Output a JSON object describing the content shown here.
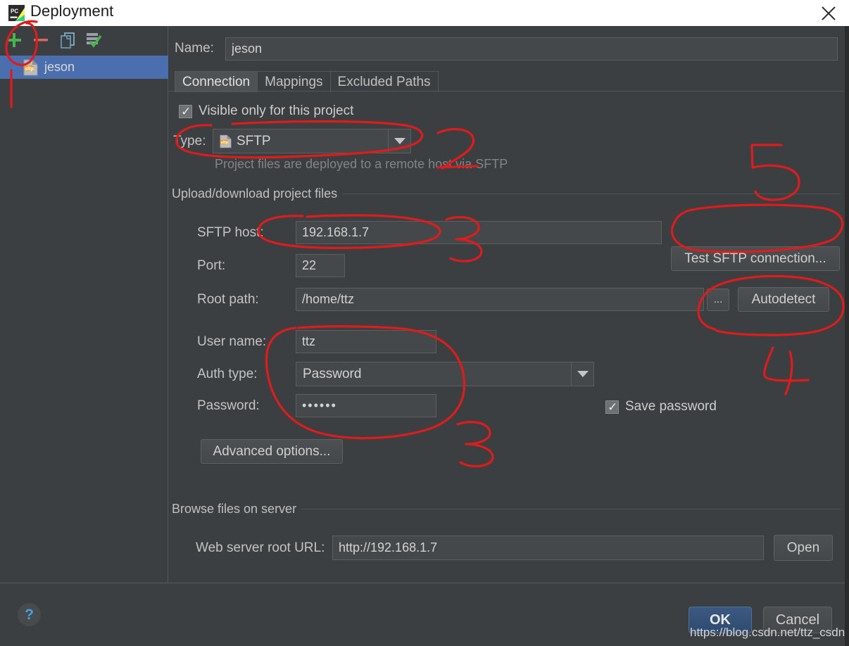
{
  "window": {
    "title": "Deployment",
    "app_icon": "pycharm-icon",
    "close_icon": "close-icon"
  },
  "sidebar": {
    "toolbar": [
      {
        "name": "add-button",
        "icon": "plus-icon",
        "label": "+"
      },
      {
        "name": "remove-button",
        "icon": "minus-icon",
        "label": "–"
      },
      {
        "name": "copy-button",
        "icon": "copy-icon",
        "label": "copy"
      },
      {
        "name": "validate-button",
        "icon": "validate-check-icon",
        "label": "validate"
      }
    ],
    "servers": [
      {
        "label": "jeson",
        "icon": "sftp-file-icon",
        "selected": true
      }
    ]
  },
  "form": {
    "name_label": "Name:",
    "name_value": "jeson",
    "tabs": [
      {
        "label": "Connection",
        "active": true
      },
      {
        "label": "Mappings",
        "active": false
      },
      {
        "label": "Excluded Paths",
        "active": false
      }
    ],
    "visible_only_label": "Visible only for this project",
    "visible_only_checked": true,
    "type_label": "Type:",
    "type_value": "SFTP",
    "type_icon": "sftp-file-icon",
    "type_hint": "Project files are deployed to a remote host via SFTP",
    "upload_group_label": "Upload/download project files",
    "host_label": "SFTP host:",
    "host_value": "192.168.1.7",
    "test_connection_label": "Test SFTP connection...",
    "port_label": "Port:",
    "port_value": "22",
    "root_path_label": "Root path:",
    "root_path_value": "/home/ttz",
    "browse_button_label": "...",
    "autodetect_label": "Autodetect",
    "user_name_label": "User name:",
    "user_name_value": "ttz",
    "auth_type_label": "Auth type:",
    "auth_type_value": "Password",
    "password_label": "Password:",
    "password_value": "••••••",
    "save_password_label": "Save password",
    "save_password_checked": true,
    "advanced_options_label": "Advanced options...",
    "browse_group_label": "Browse files on server",
    "web_url_label": "Web server root URL:",
    "web_url_value": "http://192.168.1.7",
    "open_label": "Open"
  },
  "footer": {
    "help_label": "?",
    "ok_label": "OK",
    "cancel_label": "Cancel",
    "watermark": "https://blog.csdn.net/ttz_csdn"
  },
  "annotations": {
    "marker_2": "2",
    "marker_3_host": "3",
    "marker_3_auth": "3",
    "marker_4": "4",
    "marker_5": "5",
    "color": "#e01b1b"
  },
  "colors": {
    "background": "#3c3f41",
    "titlebar": "#ffffff",
    "selection": "#4b6eaf",
    "field": "#45484a",
    "accent_ok": "#36547c",
    "annotation_red": "#e01b1b"
  }
}
